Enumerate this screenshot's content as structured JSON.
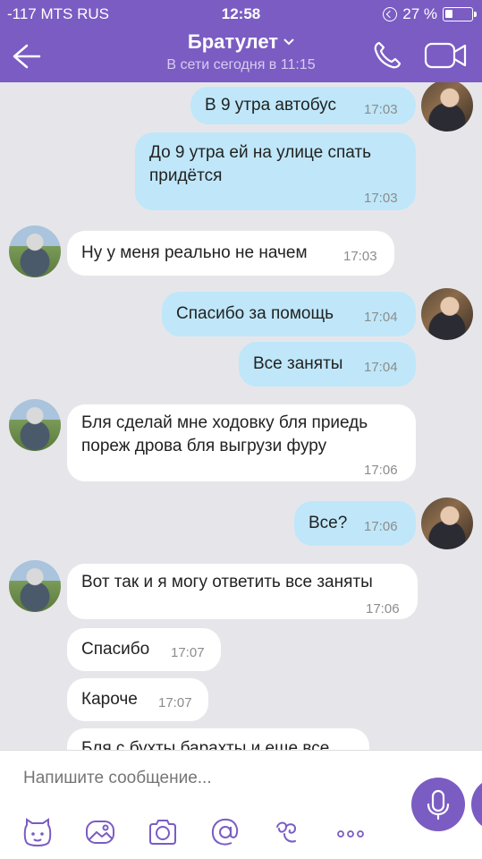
{
  "status_bar": {
    "carrier": "-117 MTS RUS",
    "time": "12:58",
    "battery": "27 %"
  },
  "header": {
    "name": "Братулет",
    "status": "В сети сегодня в 11:15"
  },
  "messages": [
    {
      "dir": "out",
      "text": "В 9 утра автобус",
      "time": "17:03"
    },
    {
      "dir": "out",
      "text": "До 9 утра ей на улице спать\nпридётся",
      "time": "17:03"
    },
    {
      "dir": "in",
      "text": "Ну у меня реально не начем",
      "time": "17:03"
    },
    {
      "dir": "out",
      "text": "Спасибо за помощь",
      "time": "17:04"
    },
    {
      "dir": "out",
      "text": "Все заняты",
      "time": "17:04"
    },
    {
      "dir": "in",
      "text": "Бля сделай мне ходовку бля приедь\nпореж дрова бля выгрузи фуру",
      "time": "17:06"
    },
    {
      "dir": "out",
      "text": "Все?",
      "time": "17:06"
    },
    {
      "dir": "in",
      "text": "Вот так и я могу ответить все заняты",
      "time": "17:06"
    },
    {
      "dir": "in",
      "text": "Спасибо",
      "time": "17:07"
    },
    {
      "dir": "in",
      "text": "Кароче",
      "time": "17:07"
    },
    {
      "dir": "in",
      "text": "Бля с бухты барахты и еще все",
      "time": ""
    }
  ],
  "composer": {
    "placeholder": "Напишите сообщение..."
  },
  "toolbar": {
    "icons": [
      "sticker-icon",
      "gallery-icon",
      "camera-icon",
      "mention-icon",
      "doodle-icon",
      "more-icon"
    ]
  },
  "colors": {
    "header": "#7b5cc3",
    "outgoing_bubble": "#bfe7f9",
    "incoming_bubble": "#ffffff",
    "background": "#e6e6ea"
  }
}
